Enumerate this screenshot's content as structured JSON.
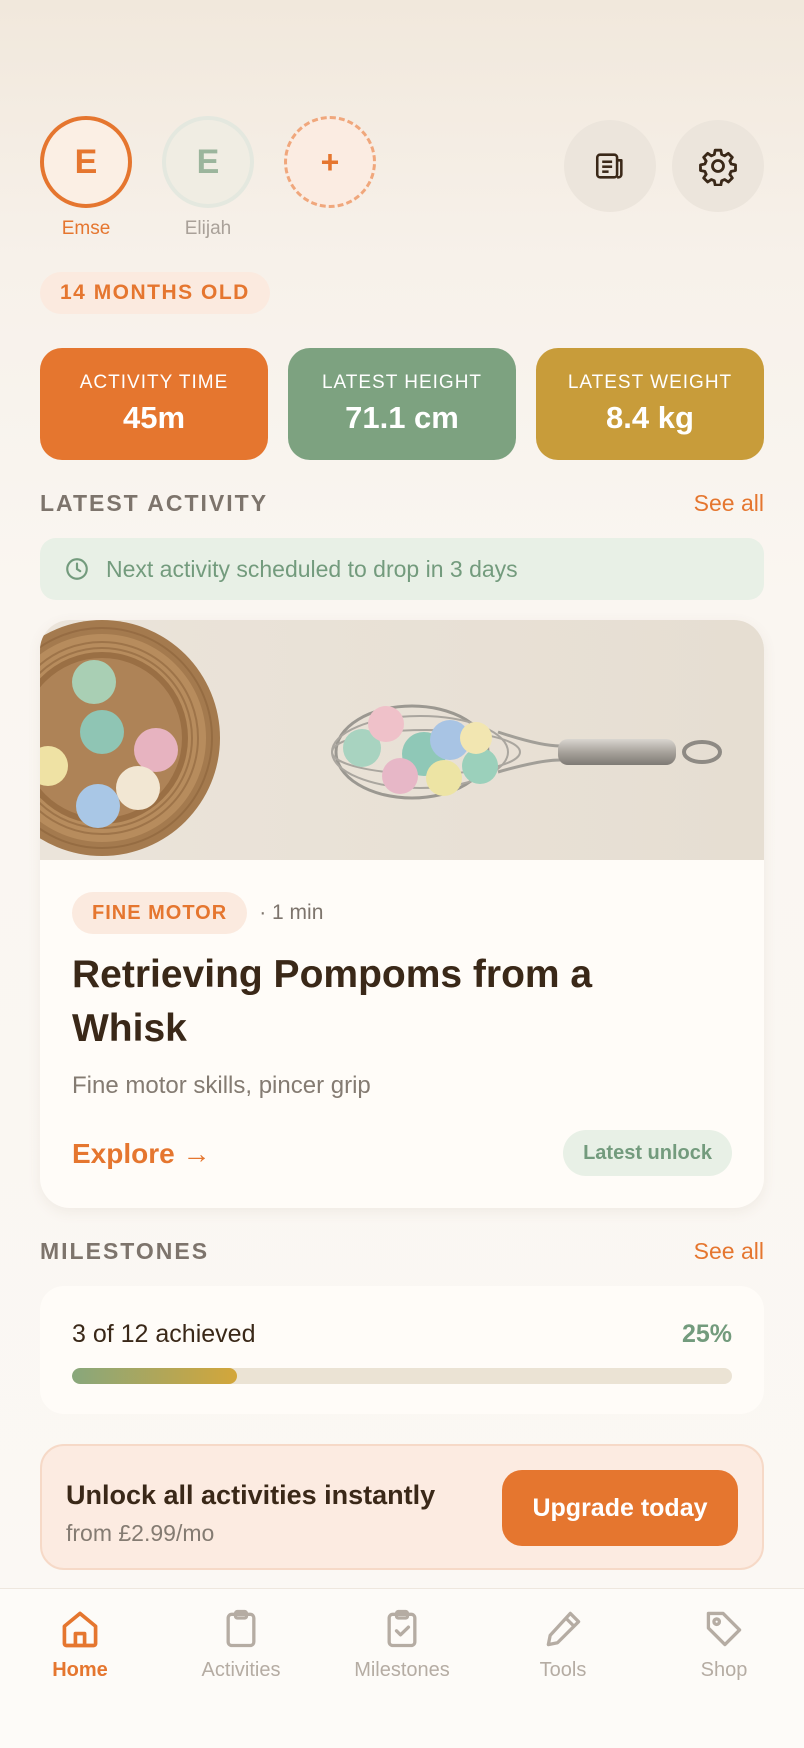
{
  "profiles": [
    {
      "initial": "E",
      "name": "Emse",
      "active": true
    },
    {
      "initial": "E",
      "name": "Elijah",
      "active": false
    }
  ],
  "add_profile_symbol": "+",
  "header_icons": [
    "notes-icon",
    "gear-icon"
  ],
  "age_label": "14 MONTHS OLD",
  "stats": [
    {
      "label": "ACTIVITY TIME",
      "value": "45m",
      "color": "#e5762f"
    },
    {
      "label": "LATEST HEIGHT",
      "value": "71.1 cm",
      "color": "#7da280"
    },
    {
      "label": "LATEST WEIGHT",
      "value": "8.4 kg",
      "color": "#c89c3a"
    }
  ],
  "latest_activity": {
    "section_title": "LATEST ACTIVITY",
    "see_all": "See all",
    "notice": "Next activity scheduled to drop in 3 days",
    "card": {
      "tag": "FINE MOTOR",
      "duration": "· 1 min",
      "title": "Retrieving Pompoms from a Whisk",
      "subtitle": "Fine motor skills, pincer grip",
      "explore": "Explore →",
      "badge": "Latest unlock"
    }
  },
  "milestones": {
    "section_title": "MILESTONES",
    "see_all": "See all",
    "achieved_text": "3 of 12 achieved",
    "achieved": 3,
    "total": 12,
    "percent_label": "25%",
    "progress": 0.25
  },
  "upgrade": {
    "title": "Unlock all activities instantly",
    "subtitle": "from £2.99/mo",
    "button": "Upgrade today"
  },
  "nav": [
    {
      "label": "Home",
      "icon": "home-icon",
      "active": true
    },
    {
      "label": "Activities",
      "icon": "clipboard-icon",
      "active": false
    },
    {
      "label": "Milestones",
      "icon": "clipboard-check-icon",
      "active": false
    },
    {
      "label": "Tools",
      "icon": "pencil-icon",
      "active": false
    },
    {
      "label": "Shop",
      "icon": "tag-icon",
      "active": false
    }
  ],
  "colors": {
    "accent": "#e5762f",
    "green": "#739b7d",
    "gold": "#c89c3a"
  }
}
